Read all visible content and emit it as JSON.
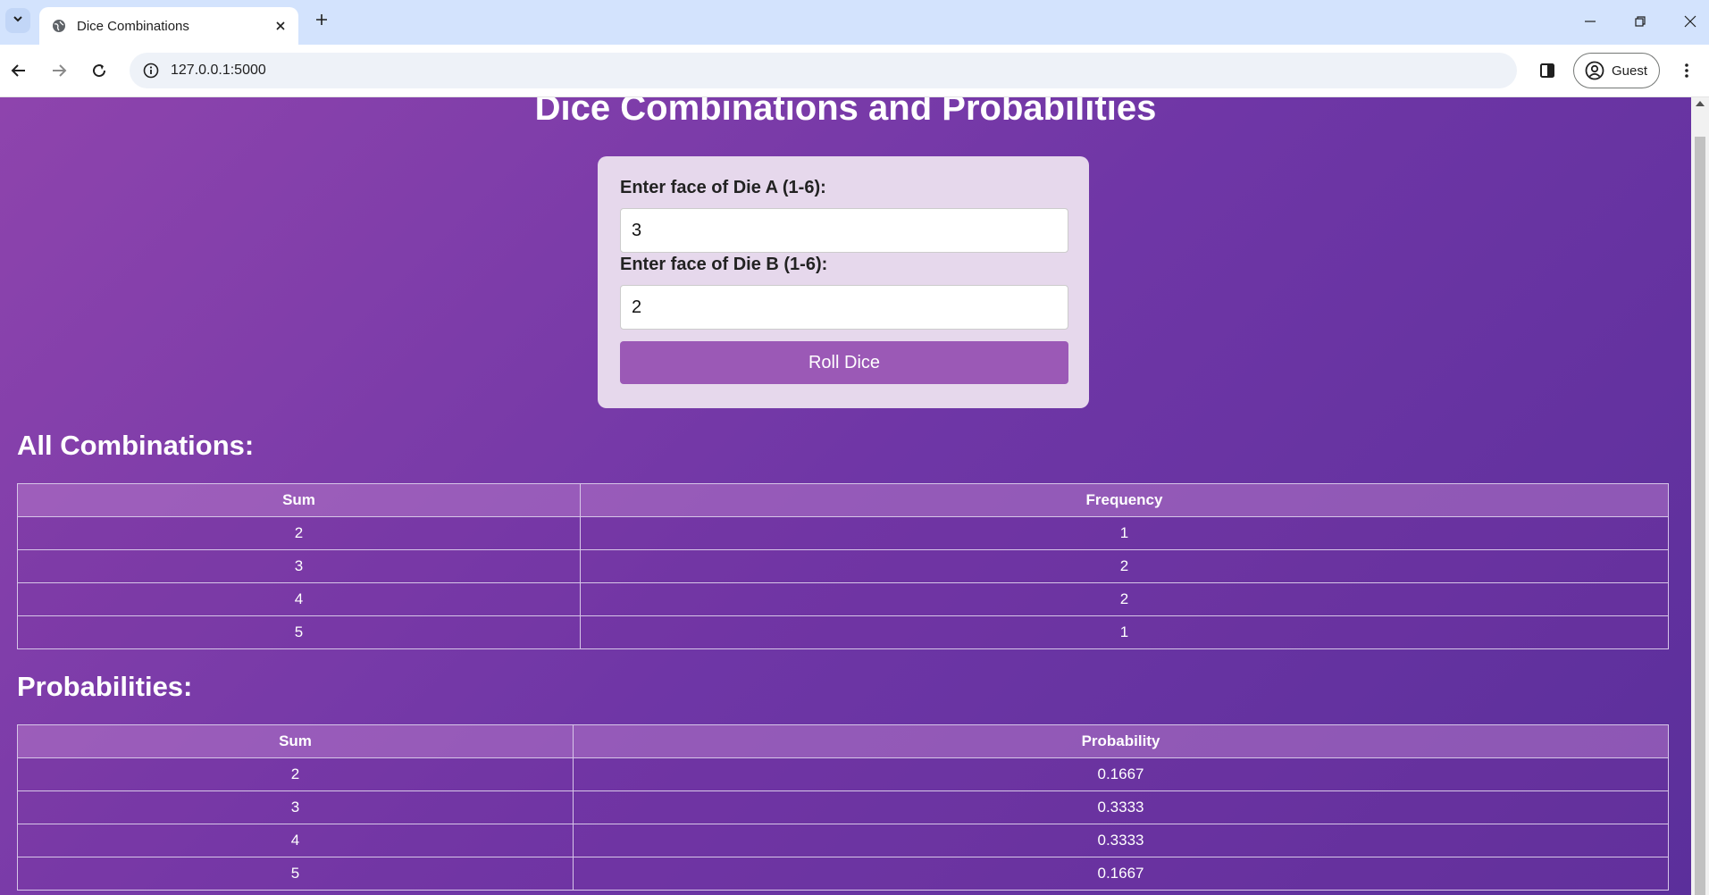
{
  "browser": {
    "tab_title": "Dice Combinations",
    "url": "127.0.0.1:5000",
    "profile_label": "Guest",
    "icons": [
      "tab-search-icon",
      "globe-icon",
      "close-icon",
      "plus-icon",
      "minimize-icon",
      "restore-icon",
      "window-close-icon",
      "back-arrow-icon",
      "forward-arrow-icon",
      "reload-icon",
      "info-icon",
      "side-panel-icon",
      "profile-icon",
      "kebab-menu-icon"
    ]
  },
  "page": {
    "title": "Dice Combinations and Probabilities",
    "form": {
      "die_a_label": "Enter face of Die A (1-6):",
      "die_a_value": "3",
      "die_b_label": "Enter face of Die B (1-6):",
      "die_b_value": "2",
      "submit_label": "Roll Dice"
    },
    "combinations": {
      "heading": "All Combinations:",
      "columns": [
        "Sum",
        "Frequency"
      ],
      "rows": [
        [
          "2",
          "1"
        ],
        [
          "3",
          "2"
        ],
        [
          "4",
          "2"
        ],
        [
          "5",
          "1"
        ]
      ]
    },
    "probabilities": {
      "heading": "Probabilities:",
      "columns": [
        "Sum",
        "Probability"
      ],
      "rows": [
        [
          "2",
          "0.1667"
        ],
        [
          "3",
          "0.3333"
        ],
        [
          "4",
          "0.3333"
        ],
        [
          "5",
          "0.1667"
        ]
      ]
    }
  }
}
